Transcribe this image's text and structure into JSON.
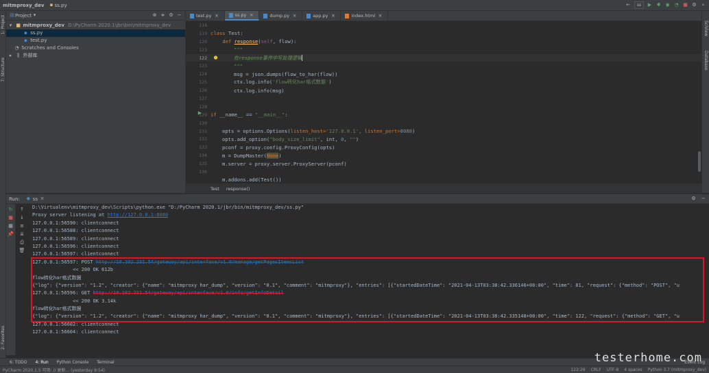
{
  "nav": {
    "project": "mitmproxy_dev",
    "file": "ss.py",
    "run_config": "ss"
  },
  "project_panel": {
    "title": "Project",
    "root": "mitmproxy_dev",
    "root_path": "D:\\PyCharm 2020.1\\jbr\\bin\\mitmproxy_dev",
    "files": [
      "ss.py",
      "test.py"
    ],
    "scratches": "Scratches and Consoles",
    "external": "外部库"
  },
  "left_strip": {
    "project": "1: Project",
    "structure": "7: Structure",
    "favorites": "2: Favorites"
  },
  "right_strip": {
    "sciview": "SciView",
    "database": "Database"
  },
  "editor": {
    "tabs": [
      "test.py",
      "ss.py",
      "dump.py",
      "app.py",
      "index.html"
    ],
    "active_tab": 1,
    "breadcrumb": [
      "Test",
      "response()"
    ]
  },
  "code": {
    "ln118": "118",
    "ln119": "119",
    "ln120": "120",
    "ln121": "121",
    "ln122": "122",
    "ln123": "123",
    "ln124": "124",
    "ln125": "125",
    "ln126": "126",
    "ln127": "127",
    "ln128": "128",
    "ln129": "129",
    "ln130": "130",
    "ln131": "131",
    "ln132": "132",
    "ln133": "133",
    "ln134": "134",
    "ln135": "135",
    "ln136": "136",
    "class_kw": "class",
    "class_name": " Test:",
    "def_kw": "def",
    "def_name": "response",
    "def_self": "self",
    "def_rest": ", flow):",
    "doc_open": "\"\"\"",
    "doc_text": "在response事件中写处理逻辑",
    "doc_close": "\"\"\"",
    "msg_line": "msg = json.dumps(flow_to_har(flow))",
    "log1_pre": "ctx.log.info(",
    "log1_str": "'flow转化har格式数据'",
    "log1_post": ")",
    "log2": "ctx.log.info(msg)",
    "if_kw": "if",
    "if_a": " __name__ == ",
    "if_str": "\"__main__\"",
    "if_colon": ":",
    "opts_pre": "opts = options.Options(",
    "opts_k1": "listen_host=",
    "opts_v1": "'127.0.0.1'",
    "opts_k2": ", listen_port=",
    "opts_v2": "8080",
    "opts_post": ")",
    "add_pre": "opts.add_option(",
    "add_str": "\"body_size_limit\"",
    "add_mid": ", int, ",
    "add_num": "0",
    "add_sep": ", ",
    "add_str2": "\"\"",
    "add_post": ")",
    "pconf": "pconf = proxy.config.ProxyConfig(opts)",
    "m_pre": "m = DumpMaster(",
    "m_none": "None",
    "m_post": ")",
    "server": "m.server = proxy.server.ProxyServer(pconf)",
    "addons": "m.addons.add(Test())"
  },
  "run": {
    "label": "Run:",
    "config": "ss"
  },
  "console": {
    "l1": "D:\\Virtualenv\\mitmproxy_dev\\Scripts\\python.exe \"D:/PyCharm 2020.1/jbr/bin/mitmproxy_dev/ss.py\"",
    "l2_pre": "Proxy server listening at ",
    "l2_link": "http://127.0.0.1:8080",
    "l3": "127.0.0.1:56590: clientconnect",
    "l4": "127.0.0.1:56588: clientconnect",
    "l5": "127.0.0.1:56589: clientconnect",
    "l6": "127.0.0.1:56596: clientconnect",
    "l7": "127.0.0.1:56597: clientconnect",
    "l8_pre": "127.0.0.1:56597: POST ",
    "l8_link": "http://10.102.231.54/gateway/api/interface/v1.0/manage/getPagesItemsList",
    "l9": "              << 200 OK 612b",
    "l10": "flow转化har格式数据",
    "l11": "{\"log\": {\"version\": \"1.2\", \"creator\": {\"name\": \"mitmproxy har_dump\", \"version\": \"0.1\", \"comment\": \"mitmproxy\"}, \"entries\": [{\"startedDateTime\": \"2021-04-13T03:38:42.336146+00:00\", \"time\": 81, \"request\": {\"method\": \"POST\", \"u",
    "l12_pre": "127.0.0.1:56596: GET ",
    "l12_link": "http://10.102.231.54/gateway/api/interface/v1.0/info/getInfoDetail",
    "l13": "              << 200 OK 3.14k",
    "l14": "flow转化har格式数据",
    "l15": "{\"log\": {\"version\": \"1.2\", \"creator\": {\"name\": \"mitmproxy har_dump\", \"version\": \"0.1\", \"comment\": \"mitmproxy\"}, \"entries\": [{\"startedDateTime\": \"2021-04-13T03:38:42.335148+00:00\", \"time\": 122, \"request\": {\"method\": \"GET\", \"u",
    "l16": "127.0.0.1:56602: clientconnect",
    "l17": "127.0.0.1:56604: clientconnect"
  },
  "bottom_tabs": [
    "6: TODO",
    "4: Run",
    "Python Console",
    "Terminal"
  ],
  "status": {
    "left": "PyCharm 2020.1.5 可用: // 更新... (yesterday 9:54)",
    "pos": "122:26",
    "crlf": "CRLF",
    "enc": "UTF-8",
    "indent": "4 spaces",
    "interp": "Python 3.7 (mitmproxy_dev)",
    "event": "Event Log"
  },
  "watermark": "testerhome.com",
  "colors": {
    "accent": "#4a88c7",
    "highlight": "#e81123"
  }
}
